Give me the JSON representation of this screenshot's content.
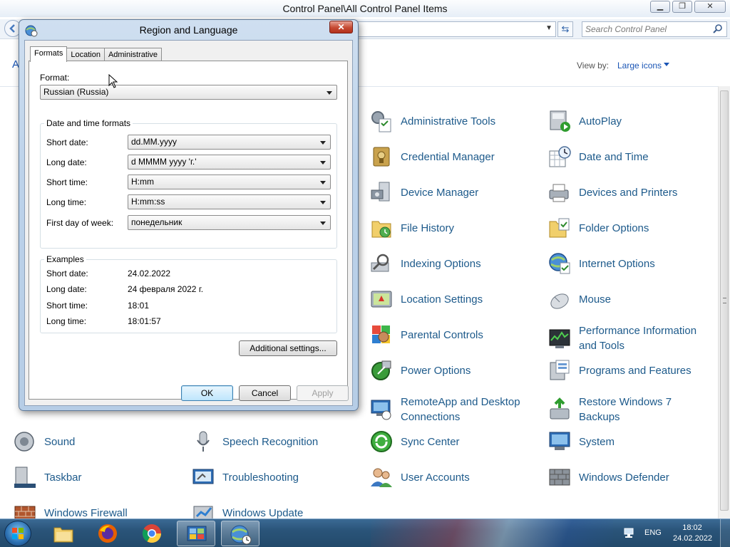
{
  "window": {
    "title": "Control Panel\\All Control Panel Items",
    "search_placeholder": "Search Control Panel",
    "view_by_label": "View by:",
    "view_by_value": "Large icons",
    "left_fragment": "A"
  },
  "items": {
    "administrative_tools": "Administrative Tools",
    "autoplay": "AutoPlay",
    "credential_manager": "Credential Manager",
    "date_and_time": "Date and Time",
    "device_manager": "Device Manager",
    "devices_and_printers": "Devices and Printers",
    "file_history": "File History",
    "folder_options": "Folder Options",
    "indexing_options": "Indexing Options",
    "internet_options": "Internet Options",
    "location_settings": "Location Settings",
    "mouse": "Mouse",
    "parental_controls": "Parental Controls",
    "performance_information": "Performance Information and Tools",
    "power_options": "Power Options",
    "programs_and_features": "Programs and Features",
    "remoteapp": "RemoteApp and Desktop Connections",
    "restore_backups": "Restore Windows 7 Backups",
    "sound": "Sound",
    "speech_recognition": "Speech Recognition",
    "sync_center": "Sync Center",
    "system": "System",
    "taskbar": "Taskbar",
    "troubleshooting": "Troubleshooting",
    "user_accounts": "User Accounts",
    "windows_defender": "Windows Defender",
    "windows_firewall": "Windows Firewall",
    "windows_update": "Windows Update"
  },
  "dialog": {
    "title": "Region and Language",
    "close": "✕",
    "tabs": [
      "Formats",
      "Location",
      "Administrative"
    ],
    "format_label": "Format:",
    "format_value": "Russian (Russia)",
    "dtf_title": "Date and time formats",
    "short_date_label": "Short date:",
    "short_date_value": "dd.MM.yyyy",
    "long_date_label": "Long date:",
    "long_date_value": "d MMMM yyyy 'г.'",
    "short_time_label": "Short time:",
    "short_time_value": "H:mm",
    "long_time_label": "Long time:",
    "long_time_value": "H:mm:ss",
    "first_day_label": "First day of week:",
    "first_day_value": "понедельник",
    "examples_title": "Examples",
    "ex_short_date": "24.02.2022",
    "ex_long_date": "24 февраля 2022 г.",
    "ex_short_time": "18:01",
    "ex_long_time": "18:01:57",
    "additional_settings": "Additional settings...",
    "ok": "OK",
    "cancel": "Cancel",
    "apply": "Apply"
  },
  "taskbar": {
    "language": "ENG",
    "time": "18:02",
    "date": "24.02.2022"
  },
  "icons": [
    "search-icon",
    "refresh-icon",
    "back-icon",
    "start-orb",
    "explorer-icon",
    "firefox-icon",
    "chrome-icon",
    "control-panel-icon",
    "region-icon",
    "network-icon"
  ]
}
